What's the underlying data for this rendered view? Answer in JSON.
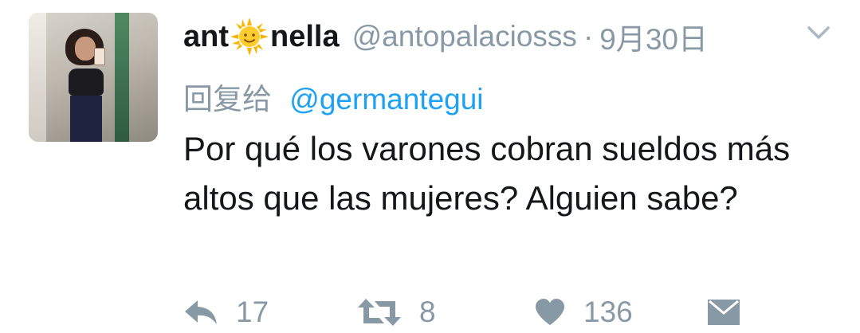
{
  "tweet": {
    "display_name_start": "ant",
    "display_name_emoji": "sun-emoji",
    "display_name_end": "nella",
    "handle": "@antopalaciosss",
    "separator": "·",
    "date": "9月30日",
    "reply_prefix": "回复给",
    "reply_mention": "@germantegui",
    "text": "Por qué los varones cobran sueldos más altos que las mujeres? Alguien sabe?"
  },
  "actions": {
    "reply_count": "17",
    "retweet_count": "8",
    "like_count": "136"
  },
  "icons": {
    "reply": "reply-icon",
    "retweet": "retweet-icon",
    "like": "heart-icon",
    "dm": "envelope-icon",
    "menu": "chevron-down-icon"
  },
  "colors": {
    "text": "#14171a",
    "secondary": "#8899a6",
    "link": "#1da1f2",
    "emoji_sun": "#f7b500"
  }
}
